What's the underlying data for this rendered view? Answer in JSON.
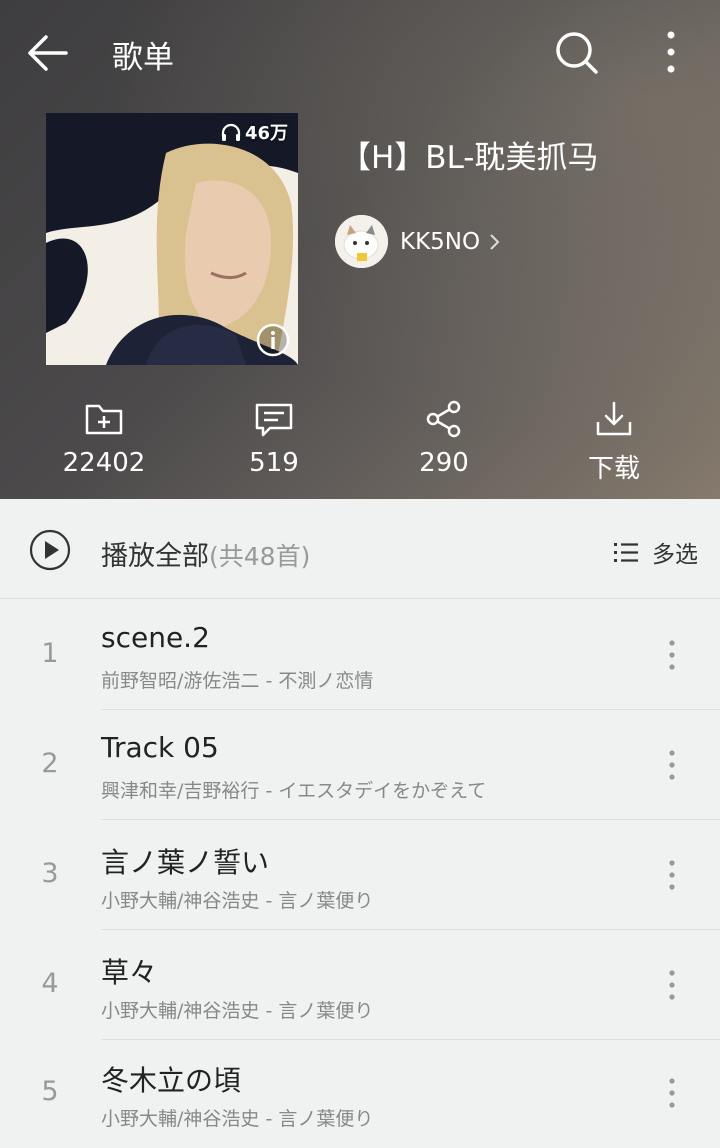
{
  "topbar": {
    "title": "歌单"
  },
  "playlist": {
    "title": "【H】BL-耽美抓马",
    "play_count": "46万",
    "creator": "KK5NO"
  },
  "stats": {
    "collect": "22402",
    "comment": "519",
    "share": "290",
    "download": "下载"
  },
  "playall": {
    "label": "播放全部",
    "count": "(共48首)",
    "multiselect": "多选"
  },
  "tracks": [
    {
      "index": "1",
      "title": "scene.2",
      "subtitle": "前野智昭/游佐浩二 - 不測ノ恋情"
    },
    {
      "index": "2",
      "title": "Track 05",
      "subtitle": "興津和幸/吉野裕行 - イエスタデイをかぞえて"
    },
    {
      "index": "3",
      "title": "言ノ葉ノ誓い",
      "subtitle": "小野大輔/神谷浩史 - 言ノ葉便り"
    },
    {
      "index": "4",
      "title": "草々",
      "subtitle": "小野大輔/神谷浩史 - 言ノ葉便り"
    },
    {
      "index": "5",
      "title": "冬木立の頃",
      "subtitle": "小野大輔/神谷浩史 - 言ノ葉便り"
    }
  ],
  "colors": {
    "header_bg": "#4c4a4b",
    "list_bg": "#f0f2f2",
    "text_secondary": "#888888"
  },
  "icons": [
    "back-arrow-icon",
    "search-icon",
    "more-vertical-icon",
    "headphones-icon",
    "info-icon",
    "chevron-right-icon",
    "folder-plus-icon",
    "comment-icon",
    "share-icon",
    "download-icon",
    "play-circle-icon",
    "list-icon"
  ]
}
